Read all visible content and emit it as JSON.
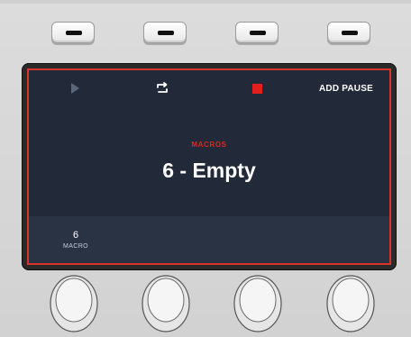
{
  "soft_buttons": [
    "button-1",
    "button-2",
    "button-3",
    "button-4"
  ],
  "status_bar": {
    "play_icon": "play-icon",
    "loop_icon": "loop-icon",
    "stop_icon": "stop-icon",
    "add_pause_label": "ADD PAUSE"
  },
  "main": {
    "section_label": "MACROS",
    "macro_name": "6 - Empty"
  },
  "bottom": {
    "macro_number": "6",
    "macro_label": "MACRO"
  },
  "colors": {
    "screen_bg": "#222a3a",
    "accent_red": "#e0261e",
    "border_red": "#d8342c"
  }
}
